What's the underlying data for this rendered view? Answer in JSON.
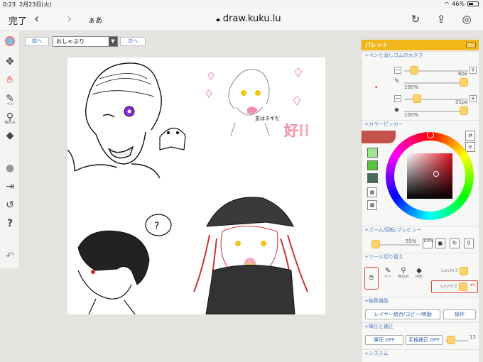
{
  "status": {
    "time": "0:23",
    "date": "2月23日(火)",
    "battery": "46%",
    "battery_level": 0.46
  },
  "browser": {
    "done_label": "完了",
    "aa_label": "ぁあ",
    "url": "draw.kuku.lu"
  },
  "icons": {
    "back": "chevron-left-icon",
    "forward": "chevron-right-icon",
    "lock": "lock-icon",
    "reload": "reload-icon",
    "share": "share-icon",
    "compass": "compass-icon"
  },
  "left_tools": {
    "pen_label": "ペン",
    "dropper_label": "色のみ"
  },
  "layer_nav": {
    "prev_label": "前へ",
    "next_label": "次へ",
    "current_layer": "おしゃぶり"
  },
  "palette": {
    "title": "パレット",
    "sections": {
      "brush_size": "+ペンと消しゴムの大きさ",
      "color_picker": "+カラーピッカー",
      "zoom": "+ズーム/回転/プレビュー",
      "tool_switch": "+ツール切り替え",
      "edit": "+編集機能",
      "pressure": "+筆圧と補正",
      "system": "+システム"
    },
    "pen": {
      "size": "6px",
      "opacity": "100%",
      "size_level": 0.1,
      "opacity_level": 1.0
    },
    "eraser": {
      "size": "21px",
      "opacity": "100%",
      "size_level": 0.15,
      "opacity_level": 1.0
    },
    "colors": {
      "primary": "#c4504c",
      "swatches": [
        "#9ee58f",
        "#56c43c",
        "#466b59"
      ]
    },
    "zoom": {
      "value": "55%",
      "level": 0.0,
      "reset_label": "100%"
    },
    "tools": {
      "pen": "ペン",
      "dropper": "色のみ",
      "circle": "円形"
    },
    "layers": [
      {
        "name": "Layer3",
        "active": false
      },
      {
        "name": "Layer2",
        "active": true
      }
    ],
    "edit": {
      "merge_label": "レイヤー統合/コピー/移動",
      "operate_label": "操作"
    },
    "pressure": {
      "pressure_label": "筆圧 OFF",
      "stabilizer_label": "手振補正 OFF",
      "value": "13",
      "level": 0.1
    }
  },
  "canvas_annotations": {
    "speech": "?",
    "note": "意はネギだ",
    "love": "好!!"
  }
}
